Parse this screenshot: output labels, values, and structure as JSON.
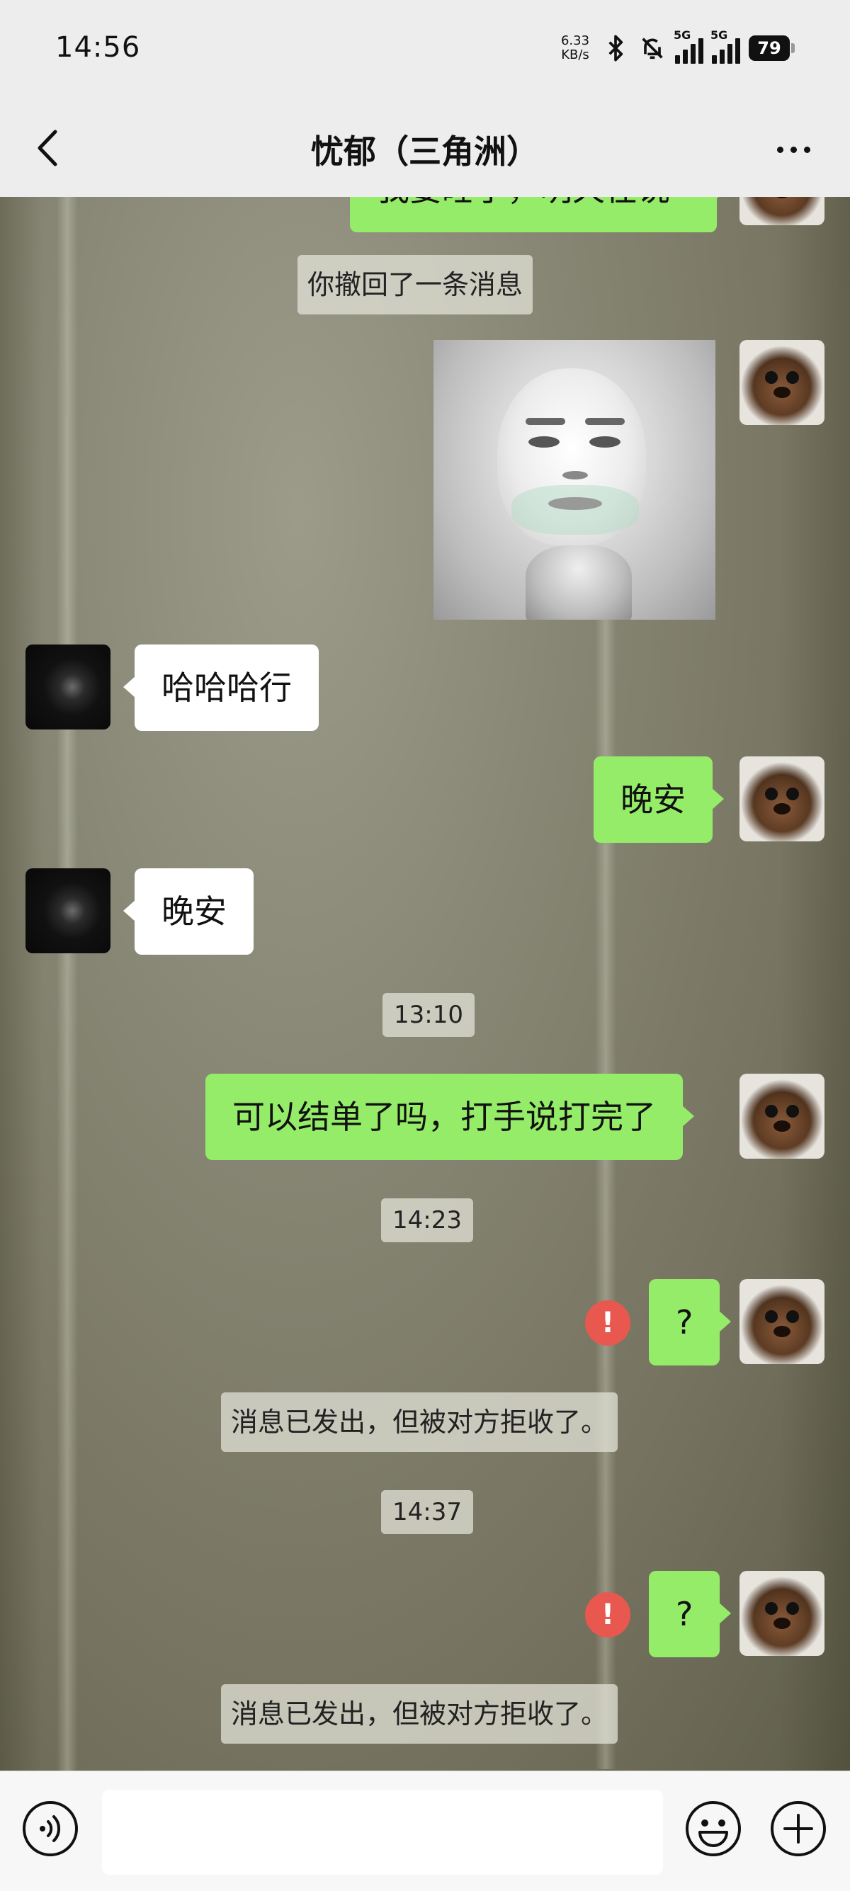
{
  "status_bar": {
    "time": "14:56",
    "net_speed_value": "6.33",
    "net_speed_unit": "KB/s",
    "signal_1": "5G",
    "signal_2": "5G",
    "battery": "79"
  },
  "header": {
    "title": "忧郁（三角洲）"
  },
  "chat": {
    "partial_top_text": "我要睡了，明天在说",
    "recall_notice": "你撤回了一条消息",
    "msg_them_1": "哈哈哈行",
    "msg_me_1": "晚安",
    "msg_them_2": "晚安",
    "time_1": "13:10",
    "msg_me_2": "可以结单了吗，打手说打完了",
    "time_2": "14:23",
    "msg_me_3": "?",
    "rejected_1": "消息已发出，但被对方拒收了。",
    "time_3": "14:37",
    "msg_me_4": "?",
    "rejected_2": "消息已发出，但被对方拒收了。",
    "error_mark": "!"
  },
  "icons": {
    "back": "chevron-left-icon",
    "more": "more-dots-icon",
    "voice": "voice-icon",
    "emoji": "emoji-icon",
    "plus": "plus-icon"
  },
  "colors": {
    "my_bubble": "#95ec69",
    "their_bubble": "#ffffff",
    "error_badge": "#e9584f",
    "chrome": "#ededed"
  }
}
